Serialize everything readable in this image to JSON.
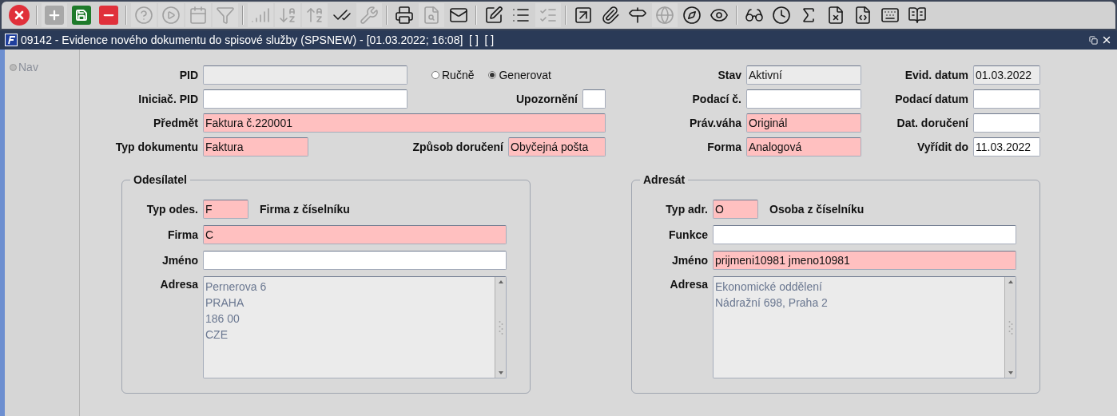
{
  "toolbar": {
    "groups": [
      [
        {
          "disabled": false
        }
      ],
      [
        {
          "disabled": true
        },
        {
          "disabled": false
        },
        {
          "disabled": false
        }
      ],
      [
        {
          "disabled": true
        },
        {
          "disabled": true
        },
        {
          "disabled": true
        },
        {
          "disabled": true
        }
      ],
      [
        {
          "disabled": true
        },
        {
          "disabled": true
        },
        {
          "disabled": true
        },
        {
          "disabled": false
        },
        {
          "disabled": true
        }
      ],
      [
        {
          "disabled": false
        },
        {
          "disabled": true
        },
        {
          "disabled": false
        }
      ],
      [
        {
          "disabled": false
        },
        {
          "disabled": false
        },
        {
          "disabled": true
        }
      ],
      [
        {
          "disabled": false
        },
        {
          "disabled": false
        },
        {
          "disabled": false
        },
        {
          "disabled": true
        },
        {
          "disabled": false
        },
        {
          "disabled": false
        }
      ],
      [
        {
          "disabled": false
        },
        {
          "disabled": false
        },
        {
          "disabled": false
        },
        {
          "disabled": false
        },
        {
          "disabled": false
        },
        {
          "disabled": false
        },
        {
          "disabled": false
        }
      ]
    ]
  },
  "window": {
    "title": "09142 - Evidence nového dokumentu do spisové služby (SPSNEW) - [01.03.2022; 16:08]  [ ]  [ ]"
  },
  "nav": {
    "label": "Nav",
    "disabled": true
  },
  "header_rows": [
    {
      "main": {
        "label": "PID",
        "kind": "readonly"
      },
      "radios": [
        {
          "label": "Ručně",
          "selected": false
        },
        {
          "label": "Generovat",
          "selected": true
        }
      ],
      "right": [
        {
          "label": "Stav",
          "value": "Aktivní",
          "kind": "readonly"
        },
        {
          "label": "Evid. datum",
          "value": "01.03.2022",
          "kind": "readonly"
        }
      ]
    },
    {
      "main": {
        "label": "Iniciač. PID",
        "kind": "normal"
      },
      "aside": {
        "label": "Upozornění",
        "kind": "normal"
      },
      "right": [
        {
          "label": "Podací č.",
          "kind": "normal"
        },
        {
          "label": "Podací datum",
          "kind": "normal"
        }
      ]
    },
    {
      "main": {
        "label": "Předmět",
        "value": "Faktura č.220001",
        "kind": "required"
      },
      "right": [
        {
          "label": "Práv.váha",
          "value": "Originál",
          "kind": "required"
        },
        {
          "label": "Dat. doručení",
          "kind": "normal"
        }
      ]
    },
    {
      "main": {
        "label": "Typ dokumentu",
        "value": "Faktura",
        "kind": "required"
      },
      "aside": {
        "label": "Způsob doručení",
        "value": "Obyčejná pošta",
        "kind": "required"
      },
      "right": [
        {
          "label": "Forma",
          "value": "Analogová",
          "kind": "required"
        },
        {
          "label": "Vyřídit do",
          "value": "11.03.2022",
          "kind": "normal"
        }
      ]
    }
  ],
  "groups": [
    {
      "title": "Odesílatel",
      "type": {
        "label": "Typ odes.",
        "value": "F",
        "kind": "required",
        "description": "Firma z číselníku"
      },
      "fields": [
        {
          "label": "Firma",
          "value": "C",
          "kind": "required"
        },
        {
          "label": "Jméno",
          "kind": "normal"
        }
      ],
      "address": {
        "label": "Adresa",
        "lines": [
          "Pernerova 6",
          "PRAHA",
          "186 00",
          "CZE"
        ]
      }
    },
    {
      "title": "Adresát",
      "type": {
        "label": "Typ adr.",
        "value": "O",
        "kind": "required",
        "description": "Osoba z číselníku"
      },
      "fields": [
        {
          "label": "Funkce",
          "kind": "normal"
        },
        {
          "label": "Jméno",
          "value": "prijmeni10981 jmeno10981",
          "kind": "required"
        }
      ],
      "address": {
        "label": "Adresa",
        "lines": [
          "Ekonomické oddělení",
          "Nádražní 698, Praha 2"
        ]
      }
    }
  ]
}
